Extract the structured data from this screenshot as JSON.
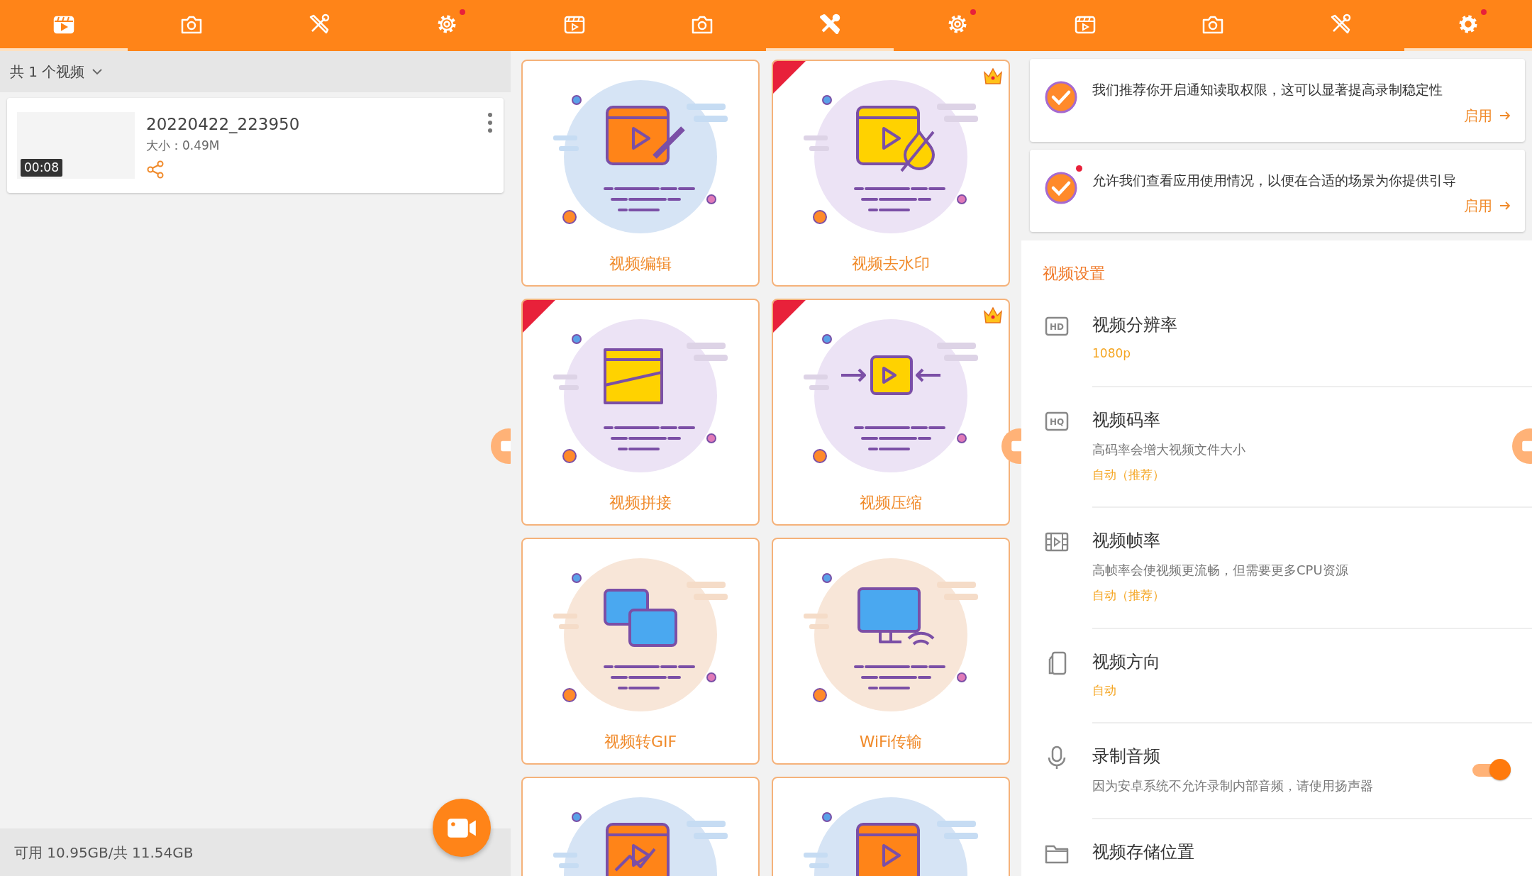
{
  "panels": [
    {
      "tabs": [
        {
          "kind": "clapper",
          "selected": true,
          "badge": false
        },
        {
          "kind": "camera",
          "selected": false,
          "badge": false
        },
        {
          "kind": "tools",
          "selected": false,
          "badge": false
        },
        {
          "kind": "gear",
          "selected": false,
          "badge": true
        }
      ],
      "video_list": {
        "summary": "共 1 个视频",
        "videos": [
          {
            "title": "20220422_223950",
            "size": "大小：0.49M",
            "duration": "00:08"
          }
        ],
        "storage": "可用 10.95GB/共 11.54GB"
      }
    },
    {
      "tabs": [
        {
          "kind": "clapper",
          "selected": false,
          "badge": false
        },
        {
          "kind": "camera",
          "selected": false,
          "badge": false
        },
        {
          "kind": "tools",
          "selected": true,
          "badge": false
        },
        {
          "kind": "gear",
          "selected": false,
          "badge": true
        }
      ],
      "tools": [
        {
          "kind": "edit",
          "label": "视频编辑",
          "new": false,
          "premium": false
        },
        {
          "kind": "watermark",
          "label": "视频去水印",
          "new": true,
          "premium": true
        },
        {
          "kind": "merge",
          "label": "视频拼接",
          "new": true,
          "premium": false
        },
        {
          "kind": "compress",
          "label": "视频压缩",
          "new": true,
          "premium": true
        },
        {
          "kind": "gif",
          "label": "视频转GIF",
          "new": false,
          "premium": false
        },
        {
          "kind": "wifi",
          "label": "WiFi传输",
          "new": false,
          "premium": false
        },
        {
          "kind": "image",
          "new": false,
          "premium": false
        },
        {
          "kind": "crop",
          "new": false,
          "premium": false
        }
      ]
    },
    {
      "tabs": [
        {
          "kind": "clapper",
          "selected": false,
          "badge": false
        },
        {
          "kind": "camera",
          "selected": false,
          "badge": false
        },
        {
          "kind": "tools",
          "selected": false,
          "badge": false
        },
        {
          "kind": "gear",
          "selected": true,
          "badge": true
        }
      ],
      "permissions": [
        {
          "text": "我们推荐你开启通知读取权限，这可以显著提高录制稳定性",
          "action": "启用",
          "badge": false
        },
        {
          "text": "允许我们查看应用使用情况，以便在合适的场景为你提供引导",
          "action": "启用",
          "badge": true
        }
      ],
      "section_title": "视频设置",
      "settings": [
        {
          "kind": "resolution",
          "icon_text": "HD",
          "title": "视频分辨率",
          "value": "1080p"
        },
        {
          "kind": "bitrate",
          "icon_text": "HQ",
          "title": "视频码率",
          "description": "高码率会增大视频文件大小",
          "value": "自动（推荐）"
        },
        {
          "kind": "framerate",
          "title": "视频帧率",
          "description": "高帧率会使视频更流畅，但需要更多CPU资源",
          "value": "自动（推荐）"
        },
        {
          "kind": "orientation",
          "title": "视频方向",
          "value": "自动"
        },
        {
          "kind": "audio",
          "title": "录制音频",
          "description": "因为安卓系统不允许录制内部音频，请使用扬声器",
          "on": true
        },
        {
          "kind": "storage",
          "title": "视频存储位置"
        }
      ]
    }
  ]
}
